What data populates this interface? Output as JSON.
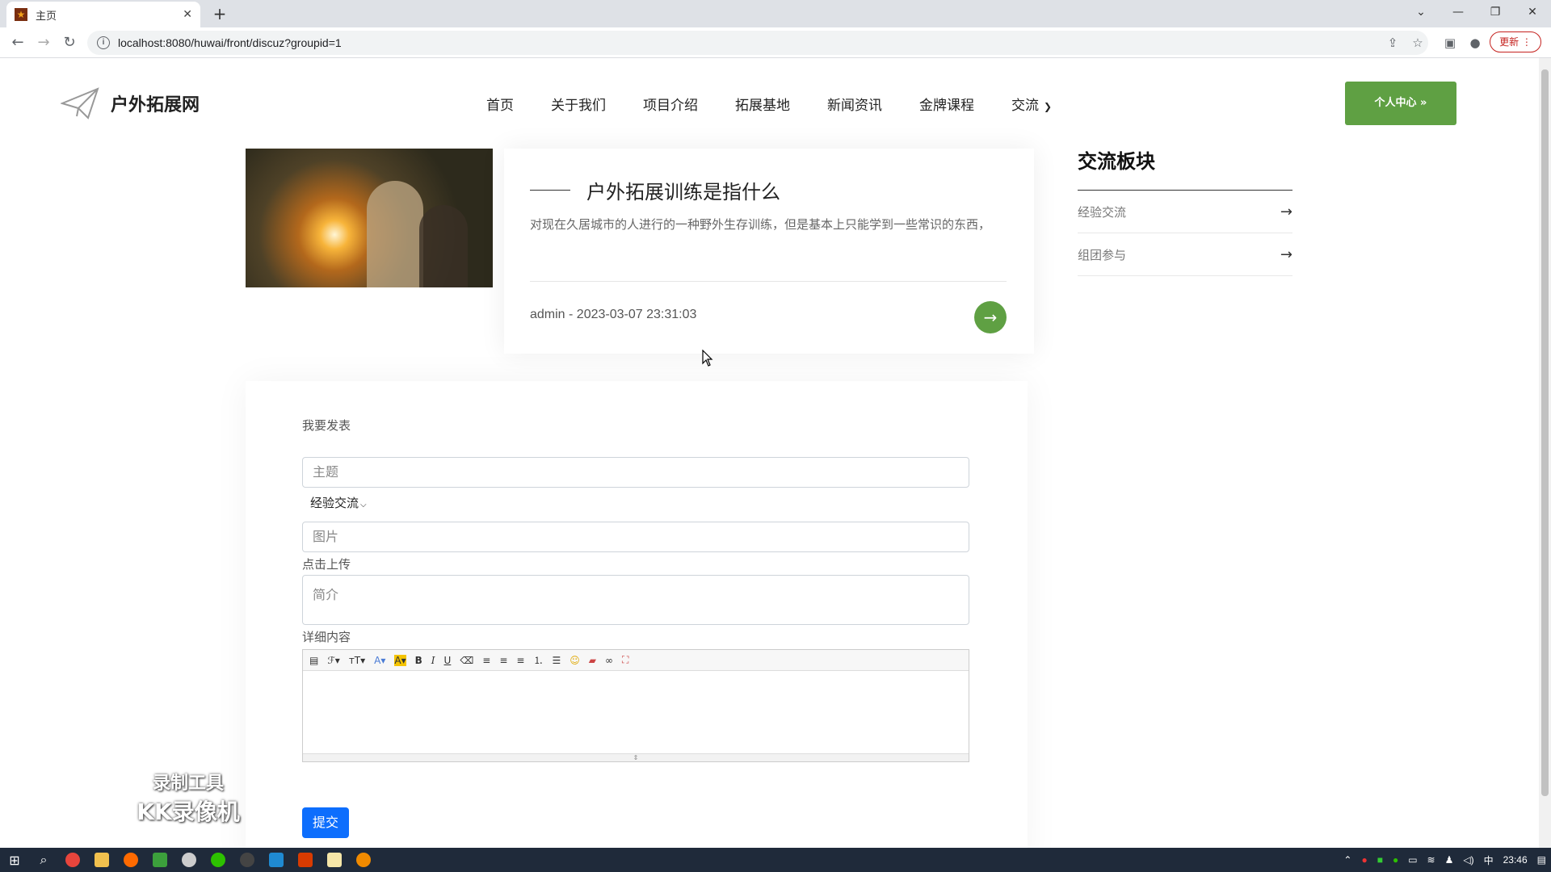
{
  "browser": {
    "tab_title": "主页",
    "url": "localhost:8080/huwai/front/discuz?groupid=1",
    "update_label": "更新"
  },
  "site": {
    "logo_text": "户外拓展网",
    "nav": [
      {
        "label": "首页"
      },
      {
        "label": "关于我们"
      },
      {
        "label": "项目介绍"
      },
      {
        "label": "拓展基地"
      },
      {
        "label": "新闻资讯"
      },
      {
        "label": "金牌课程"
      },
      {
        "label": "交流"
      }
    ],
    "personal_center": "个人中心 »"
  },
  "post": {
    "title": "户外拓展训练是指什么",
    "desc": "对现在久居城市的人进行的一种野外生存训练，但是基本上只能学到一些常识的东西，",
    "author": "admin",
    "date": "2023-03-07 23:31:03"
  },
  "sidebar": {
    "heading": "交流板块",
    "items": [
      {
        "label": "经验交流"
      },
      {
        "label": "组团参与"
      }
    ]
  },
  "form": {
    "heading": "我要发表",
    "subject_placeholder": "主题",
    "category_value": "经验交流",
    "image_placeholder": "图片",
    "upload_label": "点击上传",
    "summary_placeholder": "简介",
    "detail_label": "详细内容",
    "submit_label": "提交"
  },
  "watermark": {
    "line1": "录制工具",
    "line2": "KK录像机"
  },
  "taskbar": {
    "ime": "中",
    "time": "23:46"
  },
  "colors": {
    "accent_green": "#5fa043",
    "submit_blue": "#0d6efd"
  }
}
